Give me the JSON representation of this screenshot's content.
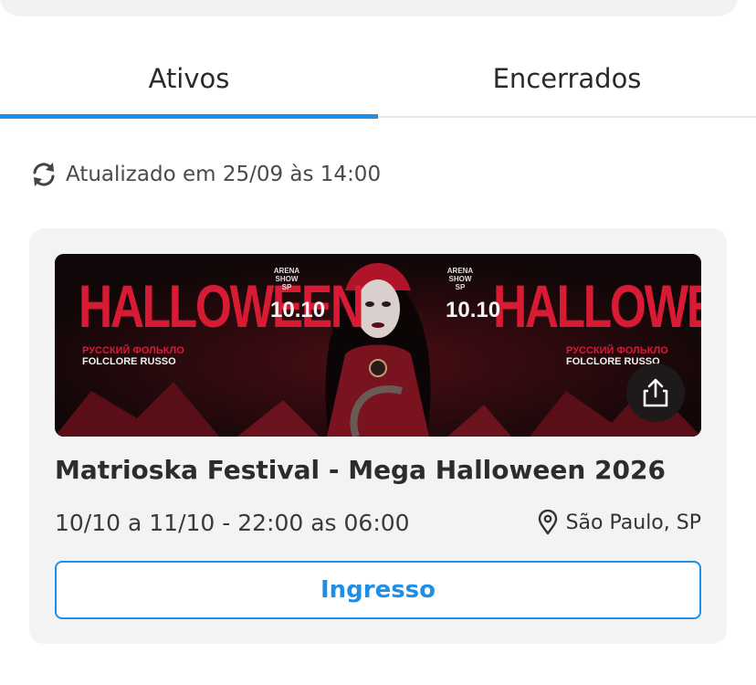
{
  "tabs": [
    {
      "label": "Ativos",
      "active": true
    },
    {
      "label": "Encerrados",
      "active": false
    }
  ],
  "status": {
    "updated_text": "Atualizado em 25/09 às 14:00",
    "icon": "refresh-icon"
  },
  "event": {
    "banner": {
      "headline": "HALLOWEEN",
      "date": "10.10",
      "venue_logo": "ARENA SHOW SP",
      "subtitle_ru": "РУССКИЙ ФОЛЬКЛО",
      "subtitle_pt": "FOLCLORE RUSSO"
    },
    "title": "Matrioska Festival - Mega Halloween 2026",
    "dates": "10/10 a 11/10 - 22:00 as 06:00",
    "location": "São Paulo, SP",
    "ticket_label": "Ingresso",
    "share_icon": "share-icon",
    "location_icon": "location-pin-icon"
  },
  "colors": {
    "accent": "#1e8ee6",
    "banner_red": "#d81b35",
    "card_bg": "#f3f3f4"
  }
}
